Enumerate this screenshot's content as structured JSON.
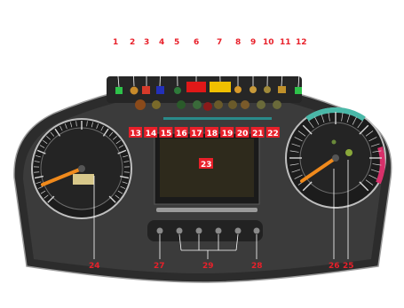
{
  "callouts": {
    "top": [
      "1",
      "2",
      "3",
      "4",
      "5",
      "6",
      "7",
      "8",
      "9",
      "10",
      "11",
      "12"
    ],
    "middle": [
      "13",
      "14",
      "15",
      "16",
      "17",
      "18",
      "19",
      "20",
      "21",
      "22"
    ],
    "screen": "23",
    "bottom_left": "24",
    "bottom_27": "27",
    "bottom_29": "29",
    "bottom_28": "28",
    "bottom_26": "26",
    "bottom_25": "25"
  },
  "colors": {
    "dash_body": "#3a3a3a",
    "dash_dark": "#1f1f1f",
    "callout_red": "#e8202a",
    "needle": "#f08a1c",
    "screen": "#2e2a1c"
  },
  "icons": {
    "warning_row": [
      "green-indicator",
      "amber-indicator",
      "red-indicator",
      "blue-indicator",
      "green-indicator",
      "red-indicator",
      "yellow-indicator",
      "amber-indicator",
      "amber-indicator",
      "amber-indicator",
      "amber-indicator",
      "green-indicator"
    ],
    "second_row": [
      "amber-lamp",
      "amber-lamp",
      "green-lamp",
      "green-lamp",
      "red-lamp",
      "amber-lamp",
      "amber-lamp",
      "amber-lamp",
      "amber-lamp",
      "amber-lamp"
    ],
    "bottom_buttons": [
      "button-1",
      "button-2",
      "button-3",
      "button-4",
      "button-5",
      "button-6"
    ]
  }
}
